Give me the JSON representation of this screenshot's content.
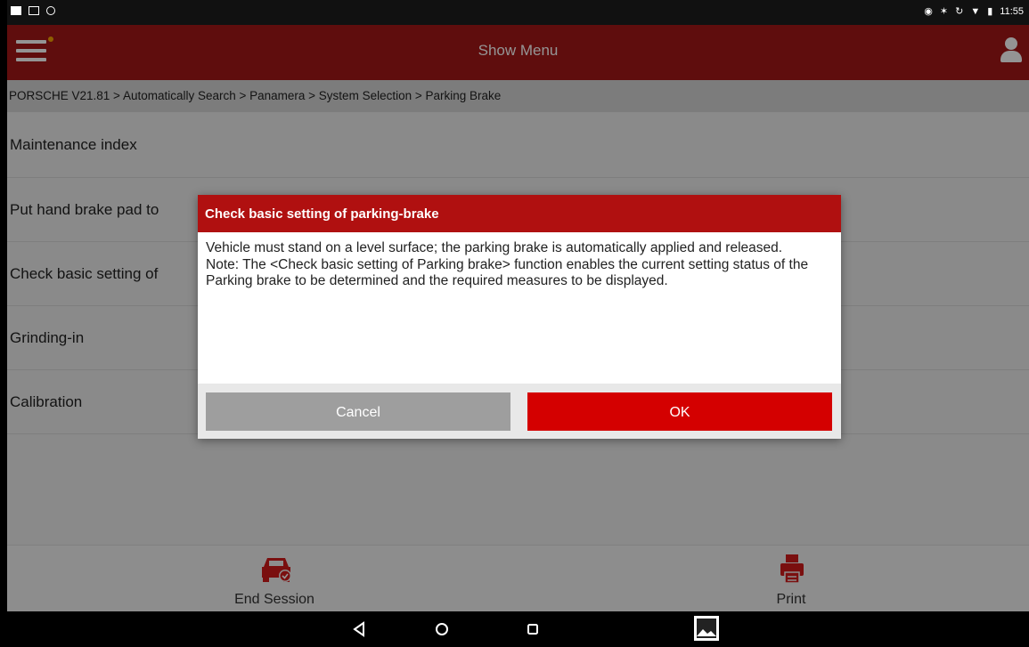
{
  "status_bar": {
    "time": "11:55"
  },
  "header": {
    "title": "Show Menu"
  },
  "breadcrumb": "PORSCHE V21.81 > Automatically Search > Panamera > System Selection > Parking Brake",
  "menu_items": [
    "Maintenance index",
    "Put hand brake pad to",
    "Check basic setting of",
    "Grinding-in",
    "Calibration"
  ],
  "toolbar": {
    "end_session": "End Session",
    "print": "Print"
  },
  "dialog": {
    "title": "Check basic setting of parking-brake",
    "paragraph1": "Vehicle must stand on a level surface; the parking brake is automatically applied and released.",
    "paragraph2": "Note: The <Check basic setting of Parking brake> function enables the current setting status of the Parking brake to be determined and the required measures to be displayed.",
    "cancel_label": "Cancel",
    "ok_label": "OK"
  },
  "colors": {
    "header": "#a41717",
    "dialog_title": "#b01010",
    "ok_button": "#d40000",
    "cancel_button": "#9e9e9e"
  },
  "icons": [
    "menu-icon",
    "user-icon",
    "end-session-car-icon",
    "print-icon",
    "back-icon",
    "home-icon",
    "recents-icon",
    "gallery-icon"
  ]
}
